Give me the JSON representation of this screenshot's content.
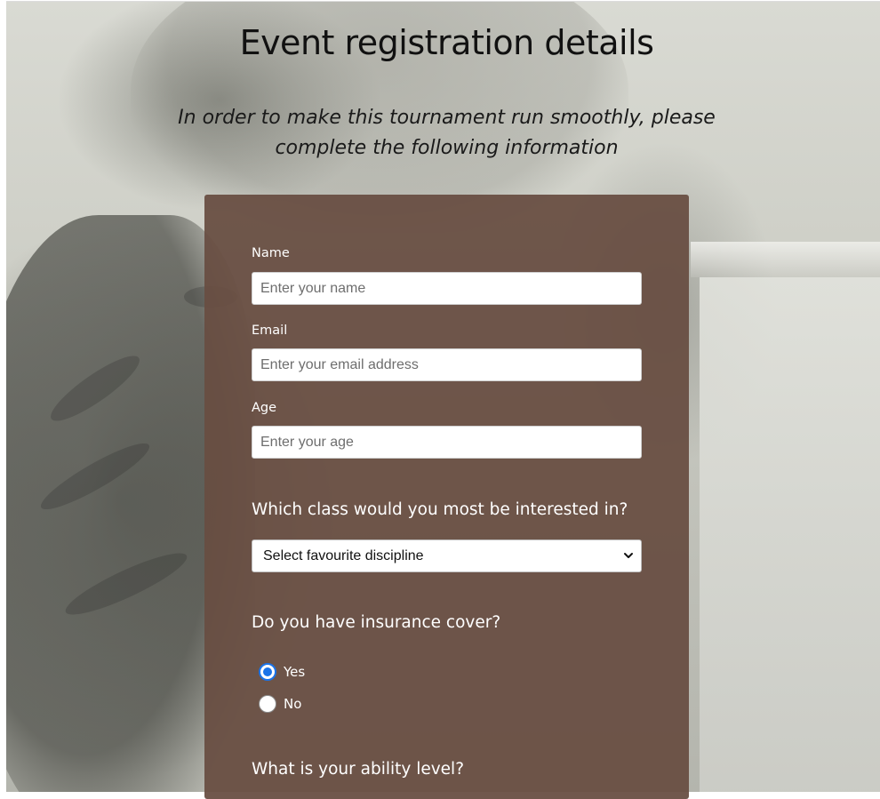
{
  "page": {
    "title": "Event registration details",
    "subtitle": "In order to make this tournament run smoothly, please complete the following information"
  },
  "form": {
    "name": {
      "label": "Name",
      "placeholder": "Enter your name"
    },
    "email": {
      "label": "Email",
      "placeholder": "Enter your email address"
    },
    "age": {
      "label": "Age",
      "placeholder": "Enter your age"
    },
    "class_question": "Which class would you most be interested in?",
    "class_select": {
      "selected": "Select favourite discipline"
    },
    "insurance_question": "Do you have insurance cover?",
    "insurance_options": [
      {
        "label": "Yes",
        "checked": true
      },
      {
        "label": "No",
        "checked": false
      }
    ],
    "ability_question": "What is your ability level?"
  },
  "colors": {
    "card_background": "#684e42",
    "radio_accent": "#1a73e8",
    "text_on_card": "#ffffff"
  },
  "icons": {
    "select_caret": "chevron-down-icon"
  }
}
